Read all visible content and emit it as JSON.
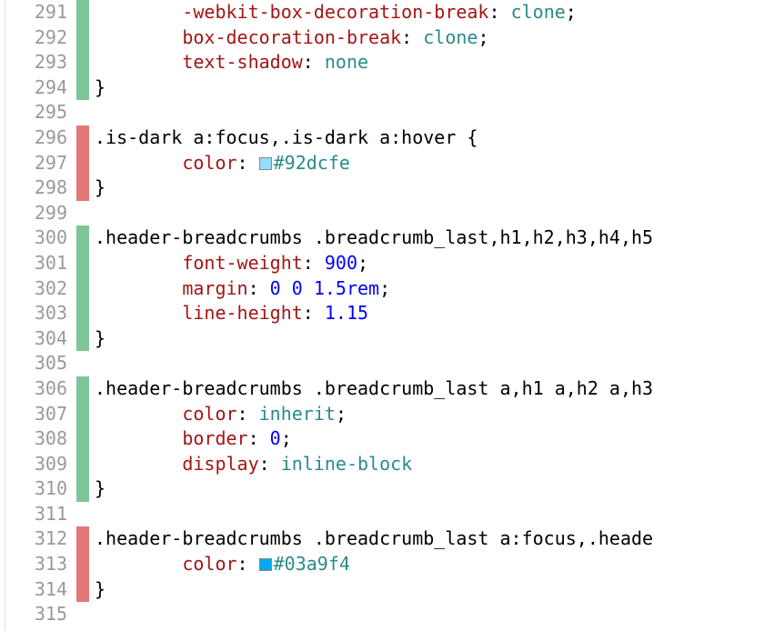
{
  "lines": [
    {
      "n": 291,
      "diff": "added",
      "indent": 2,
      "prop": "-webkit-box-decoration-break",
      "value": "clone",
      "val_type": "ident",
      "trailing": ";"
    },
    {
      "n": 292,
      "diff": "added",
      "indent": 2,
      "prop": "box-decoration-break",
      "value": "clone",
      "val_type": "ident",
      "trailing": ";"
    },
    {
      "n": 293,
      "diff": "added",
      "indent": 2,
      "prop": "text-shadow",
      "value": "none",
      "val_type": "ident",
      "trailing": ""
    },
    {
      "n": 294,
      "diff": "added",
      "indent": 0,
      "raw": "}"
    },
    {
      "n": 295,
      "diff": "",
      "indent": 0,
      "raw": ""
    },
    {
      "n": 296,
      "diff": "removed",
      "indent": 0,
      "selector": ".is-dark a:focus,.is-dark a:hover {"
    },
    {
      "n": 297,
      "diff": "removed",
      "indent": 2,
      "prop": "color",
      "value": "#92dcfe",
      "val_type": "color",
      "swatch": "#92dcfe",
      "trailing": ""
    },
    {
      "n": 298,
      "diff": "removed",
      "indent": 0,
      "raw": "}"
    },
    {
      "n": 299,
      "diff": "",
      "indent": 0,
      "raw": ""
    },
    {
      "n": 300,
      "diff": "added",
      "indent": 0,
      "selector": ".header-breadcrumbs .breadcrumb_last,h1,h2,h3,h4,h5"
    },
    {
      "n": 301,
      "diff": "added",
      "indent": 2,
      "prop": "font-weight",
      "value": "900",
      "val_type": "num",
      "trailing": ";"
    },
    {
      "n": 302,
      "diff": "added",
      "indent": 2,
      "prop": "margin",
      "value": "0 0 1.5rem",
      "val_type": "num",
      "trailing": ";"
    },
    {
      "n": 303,
      "diff": "added",
      "indent": 2,
      "prop": "line-height",
      "value": "1.15",
      "val_type": "num",
      "trailing": ""
    },
    {
      "n": 304,
      "diff": "added",
      "indent": 0,
      "raw": "}"
    },
    {
      "n": 305,
      "diff": "",
      "indent": 0,
      "raw": ""
    },
    {
      "n": 306,
      "diff": "added",
      "indent": 0,
      "selector": ".header-breadcrumbs .breadcrumb_last a,h1 a,h2 a,h3"
    },
    {
      "n": 307,
      "diff": "added",
      "indent": 2,
      "prop": "color",
      "value": "inherit",
      "val_type": "ident",
      "trailing": ";"
    },
    {
      "n": 308,
      "diff": "added",
      "indent": 2,
      "prop": "border",
      "value": "0",
      "val_type": "num",
      "trailing": ";"
    },
    {
      "n": 309,
      "diff": "added",
      "indent": 2,
      "prop": "display",
      "value": "inline-block",
      "val_type": "ident",
      "trailing": ""
    },
    {
      "n": 310,
      "diff": "added",
      "indent": 0,
      "raw": "}"
    },
    {
      "n": 311,
      "diff": "",
      "indent": 0,
      "raw": ""
    },
    {
      "n": 312,
      "diff": "removed",
      "indent": 0,
      "selector": ".header-breadcrumbs .breadcrumb_last a:focus,.heade"
    },
    {
      "n": 313,
      "diff": "removed",
      "indent": 2,
      "prop": "color",
      "value": "#03a9f4",
      "val_type": "color",
      "swatch": "#03a9f4",
      "trailing": ""
    },
    {
      "n": 314,
      "diff": "removed",
      "indent": 0,
      "raw": "}"
    },
    {
      "n": 315,
      "diff": "",
      "indent": 0,
      "raw": ""
    }
  ]
}
